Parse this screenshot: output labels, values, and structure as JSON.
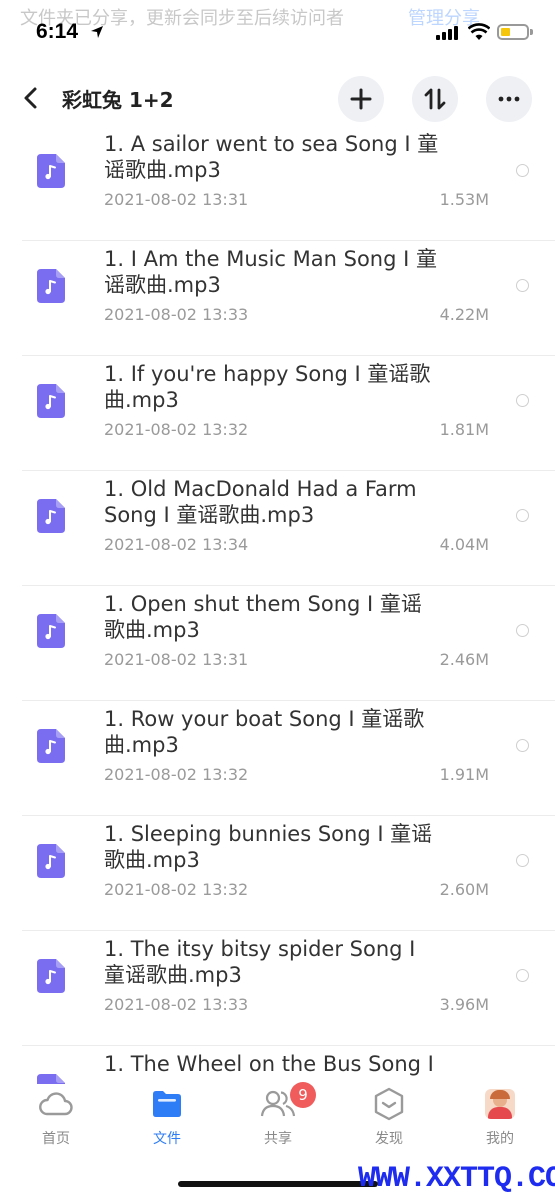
{
  "status_bar": {
    "time": "6:14",
    "banner_text": "文件夹已分享，更新会同步至后续访问者",
    "banner_link": "管理分享"
  },
  "nav": {
    "title": "彩虹兔 1+2",
    "back_icon": "chevron-left-icon",
    "actions": [
      "plus-icon",
      "sort-icon",
      "more-icon"
    ]
  },
  "files": [
    {
      "name": "1. A sailor went to sea Song I 童谣歌曲.mp3",
      "date": "2021-08-02 13:31",
      "size": "1.53M"
    },
    {
      "name": "1. I Am the Music Man Song I 童谣歌曲.mp3",
      "date": "2021-08-02 13:33",
      "size": "4.22M"
    },
    {
      "name": "1. If you're happy Song I 童谣歌曲.mp3",
      "date": "2021-08-02 13:32",
      "size": "1.81M"
    },
    {
      "name": "1. Old MacDonald Had a Farm Song I 童谣歌曲.mp3",
      "date": "2021-08-02 13:34",
      "size": "4.04M"
    },
    {
      "name": "1. Open shut them Song I 童谣歌曲.mp3",
      "date": "2021-08-02 13:31",
      "size": "2.46M"
    },
    {
      "name": "1. Row your boat Song I 童谣歌曲.mp3",
      "date": "2021-08-02 13:32",
      "size": "1.91M"
    },
    {
      "name": "1. Sleeping bunnies Song I 童谣歌曲.mp3",
      "date": "2021-08-02 13:32",
      "size": "2.60M"
    },
    {
      "name": "1. The itsy bitsy spider Song I 童谣歌曲.mp3",
      "date": "2021-08-02 13:33",
      "size": "3.96M"
    },
    {
      "name": "1. The Wheel on the Bus Song I",
      "date": "",
      "size": ""
    }
  ],
  "tabs": [
    {
      "label": "首页",
      "icon": "cloud-icon"
    },
    {
      "label": "文件",
      "icon": "folder-icon"
    },
    {
      "label": "共享",
      "icon": "people-icon",
      "badge": "9"
    },
    {
      "label": "发现",
      "icon": "discover-icon"
    },
    {
      "label": "我的",
      "icon": "avatar"
    }
  ],
  "watermark": "WWW.XXTTQ.COM",
  "colors": {
    "accent": "#2f7df6",
    "file_icon": "#7a6df0",
    "badge": "#f05b5b",
    "battery": "#f6c60b"
  }
}
